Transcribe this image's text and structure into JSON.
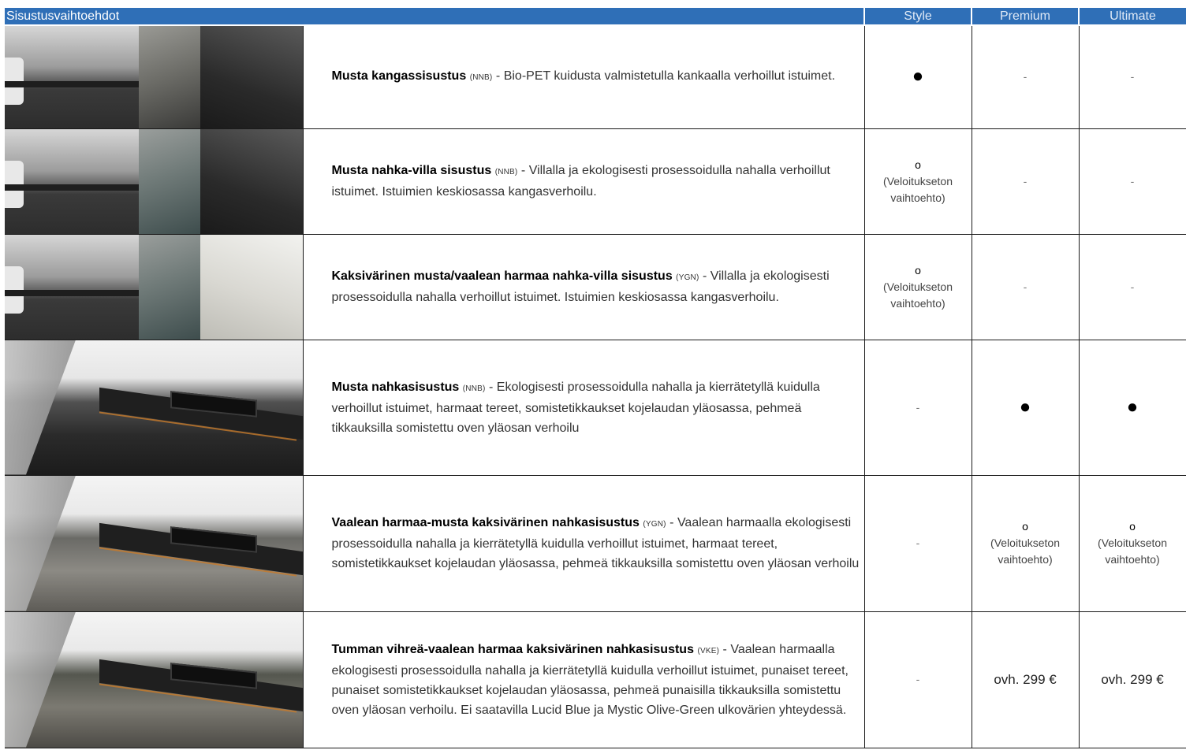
{
  "header": {
    "title": "Sisustusvaihtoehdot",
    "trims": [
      "Style",
      "Premium",
      "Ultimate"
    ]
  },
  "rows": [
    {
      "name": "Musta kangassisustus",
      "code": "(NNB)",
      "desc": " - Bio-PET kuidusta valmistetulla kankaalla verhoillut istuimet.",
      "style": "●",
      "premium": "-",
      "ultimate": "-"
    },
    {
      "name": "Musta nahka-villa sisustus",
      "code": "(NNB)",
      "desc": " - Villalla ja ekologisesti prosessoidulla nahalla verhoillut istuimet. Istuimien keskiosassa kangasverhoilu.",
      "style": "o",
      "style_note_1": "(Veloitukseton",
      "style_note_2": "vaihtoehto)",
      "premium": "-",
      "ultimate": "-"
    },
    {
      "name": "Kaksivärinen musta/vaalean harmaa nahka-villa sisustus",
      "code": "(YGN)",
      "desc": " - Villalla ja ekologisesti prosessoidulla nahalla verhoillut istuimet. Istuimien keskiosassa kangasverhoilu.",
      "style": "o",
      "style_note_1": "(Veloitukseton",
      "style_note_2": "vaihtoehto)",
      "premium": "-",
      "ultimate": "-"
    },
    {
      "name": "Musta nahkasisustus",
      "code": "(NNB)",
      "desc": " - Ekologisesti prosessoidulla nahalla ja kierrätetyllä kuidulla verhoillut istuimet, harmaat tereet, somistetikkaukset kojelaudan yläosassa, pehmeä tikkauksilla somistettu oven yläosan verhoilu",
      "style": "-",
      "premium": "●",
      "ultimate": "●"
    },
    {
      "name": "Vaalean harmaa-musta kaksivärinen nahkasisustus",
      "code": "(YGN)",
      "desc": " - Vaalean harmaalla ekologisesti prosessoidulla nahalla ja kierrätetyllä kuidulla verhoillut istuimet, harmaat tereet, somistetikkaukset kojelaudan yläosassa, pehmeä tikkauksilla somistettu oven yläosan verhoilu",
      "style": "-",
      "premium": "o",
      "premium_note_1": "(Veloitukseton",
      "premium_note_2": "vaihtoehto)",
      "ultimate": "o",
      "ultimate_note_1": "(Veloitukseton",
      "ultimate_note_2": "vaihtoehto)"
    },
    {
      "name": "Tumman vihreä-vaalean harmaa kaksivärinen nahkasisustus",
      "code": "(VKE)",
      "desc": " - Vaalean harmaalla ekologisesti prosessoidulla nahalla ja kierrätetyllä kuidulla verhoillut istuimet, punaiset tereet, punaiset somistetikkaukset kojelaudan yläosassa, pehmeä punaisilla tikkauksilla somistettu oven yläosan verhoilu. Ei saatavilla Lucid Blue ja Mystic Olive-Green ulkovärien yhteydessä.",
      "style": "-",
      "premium": "ovh. 299 €",
      "ultimate": "ovh. 299 €"
    }
  ],
  "colors": {
    "header_bg": "#2f6fb7",
    "header_text": "#ffffff"
  }
}
